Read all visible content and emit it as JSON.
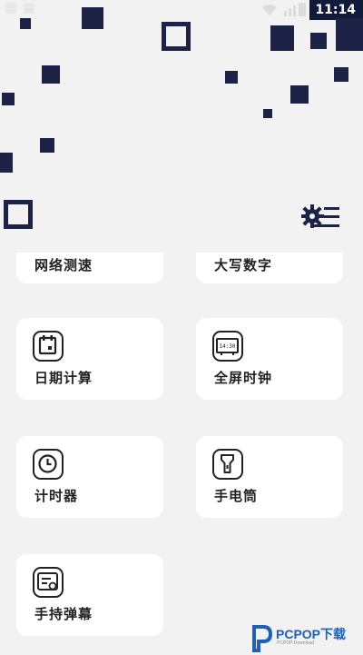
{
  "status_bar": {
    "time": "11:14"
  },
  "header": {
    "settings_icon": "gear-list-icon"
  },
  "tools": [
    {
      "label": "网络测速",
      "icon": "network-speed-icon"
    },
    {
      "label": "大写数字",
      "icon": "uppercase-number-icon"
    },
    {
      "label": "日期计算",
      "icon": "calendar-icon"
    },
    {
      "label": "全屏时钟",
      "icon": "fullscreen-clock-icon",
      "icon_text": "14:30"
    },
    {
      "label": "计时器",
      "icon": "timer-clock-icon"
    },
    {
      "label": "手电筒",
      "icon": "flashlight-icon"
    },
    {
      "label": "手持弹幕",
      "icon": "handheld-barrage-icon"
    }
  ],
  "watermark": {
    "brand": "PCPOP下载",
    "sub": "PCPOP Download"
  },
  "colors": {
    "accent": "#1c2347",
    "background": "#f2f2f2",
    "card": "#ffffff",
    "watermark": "#1f5fb8"
  }
}
